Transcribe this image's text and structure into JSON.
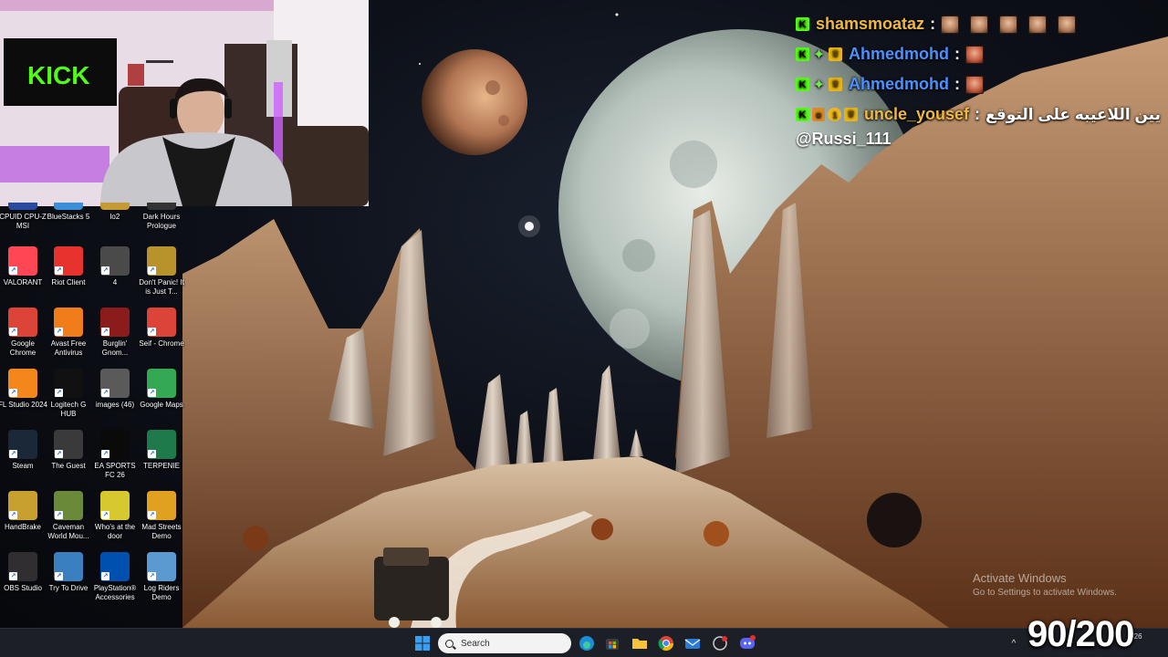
{
  "desktop": {
    "icons": [
      {
        "label": "CPUID CPU-Z MSI",
        "icon": "cpuz-icon",
        "color": "#2a4aa0",
        "partial": true
      },
      {
        "label": "BlueStacks 5",
        "icon": "bluestacks-icon",
        "color": "#3a8fd8",
        "partial": true
      },
      {
        "label": "lo2",
        "icon": "folder-icon",
        "color": "#c79a38",
        "partial": true
      },
      {
        "label": "Dark Hours Prologue",
        "icon": "dark-hours-icon",
        "color": "#333333",
        "partial": true
      },
      {
        "label": "VALORANT",
        "icon": "valorant-icon",
        "color": "#ff4655"
      },
      {
        "label": "Riot Client",
        "icon": "riot-client-icon",
        "color": "#e8322e"
      },
      {
        "label": "4",
        "icon": "image-file-icon",
        "color": "#4a4a4a"
      },
      {
        "label": "Don't Panic! It is Just T...",
        "icon": "dont-panic-icon",
        "color": "#b8932c"
      },
      {
        "label": "Google Chrome",
        "icon": "chrome-icon",
        "color": "#db4437"
      },
      {
        "label": "Avast Free Antivirus",
        "icon": "avast-icon",
        "color": "#f07c1a"
      },
      {
        "label": "Burglin' Gnom...",
        "icon": "burglin-gnomes-icon",
        "color": "#8a1c1c"
      },
      {
        "label": "Seif - Chrome",
        "icon": "chrome-profile-icon",
        "color": "#db4437"
      },
      {
        "label": "FL Studio 2024",
        "icon": "fl-studio-icon",
        "color": "#f3871c"
      },
      {
        "label": "Logitech G HUB",
        "icon": "logitech-ghub-icon",
        "color": "#111111"
      },
      {
        "label": "images (46)",
        "icon": "image-file-icon",
        "color": "#5a5a5a"
      },
      {
        "label": "Google Maps",
        "icon": "google-maps-icon",
        "color": "#34a853"
      },
      {
        "label": "Steam",
        "icon": "steam-icon",
        "color": "#1b2838"
      },
      {
        "label": "The Guest",
        "icon": "the-guest-icon",
        "color": "#3a3a3a"
      },
      {
        "label": "EA SPORTS FC 26",
        "icon": "ea-fc-icon",
        "color": "#0a0a0a"
      },
      {
        "label": "TERPENIE",
        "icon": "terpenie-icon",
        "color": "#1e7a4a"
      },
      {
        "label": "HandBrake",
        "icon": "handbrake-icon",
        "color": "#c8a030"
      },
      {
        "label": "Caveman World Mou...",
        "icon": "caveman-icon",
        "color": "#6a8a3a"
      },
      {
        "label": "Who's at the door",
        "icon": "whos-at-door-icon",
        "color": "#d8c830"
      },
      {
        "label": "Mad Streets Demo",
        "icon": "mad-streets-icon",
        "color": "#e0a020"
      },
      {
        "label": "OBS Studio",
        "icon": "obs-icon",
        "color": "#302e31"
      },
      {
        "label": "Try To Drive",
        "icon": "try-to-drive-icon",
        "color": "#3a80c0"
      },
      {
        "label": "PlayStation® Accessories",
        "icon": "playstation-icon",
        "color": "#0050b0"
      },
      {
        "label": "Log Riders Demo",
        "icon": "log-riders-icon",
        "color": "#5a9ad0"
      }
    ]
  },
  "chat": {
    "messages": [
      {
        "username": "shamsmoataz",
        "user_color": "#f0b840",
        "badges": [
          "kick"
        ],
        "separator": ":",
        "text": "",
        "emotes": 5
      },
      {
        "username": "Ahmedmohd",
        "user_color": "#4a90ff",
        "badges": [
          "kick",
          "plus",
          "crown"
        ],
        "separator": ":",
        "text": "",
        "emotes": 1
      },
      {
        "username": "Ahmedmohd",
        "user_color": "#4a90ff",
        "badges": [
          "kick",
          "plus",
          "crown"
        ],
        "separator": ":",
        "text": "",
        "emotes": 1
      },
      {
        "username": "uncle_yousef",
        "user_color": "#f0b840",
        "badges": [
          "kick",
          "box",
          "coin",
          "crown"
        ],
        "separator": ":",
        "text": "يين اللاعيبه على التوقع",
        "emotes": 0
      }
    ],
    "mention": "@Russi_111"
  },
  "watermark": {
    "line1": "Activate Windows",
    "line2": "Go to Settings to activate Windows."
  },
  "counter": "90/200",
  "taskbar": {
    "search_placeholder": "Search",
    "tray_time": "3/26",
    "apps": [
      "start-icon",
      "edge-icon",
      "store-icon",
      "file-explorer-icon",
      "chrome-icon",
      "mail-icon",
      "discord-icon"
    ]
  }
}
